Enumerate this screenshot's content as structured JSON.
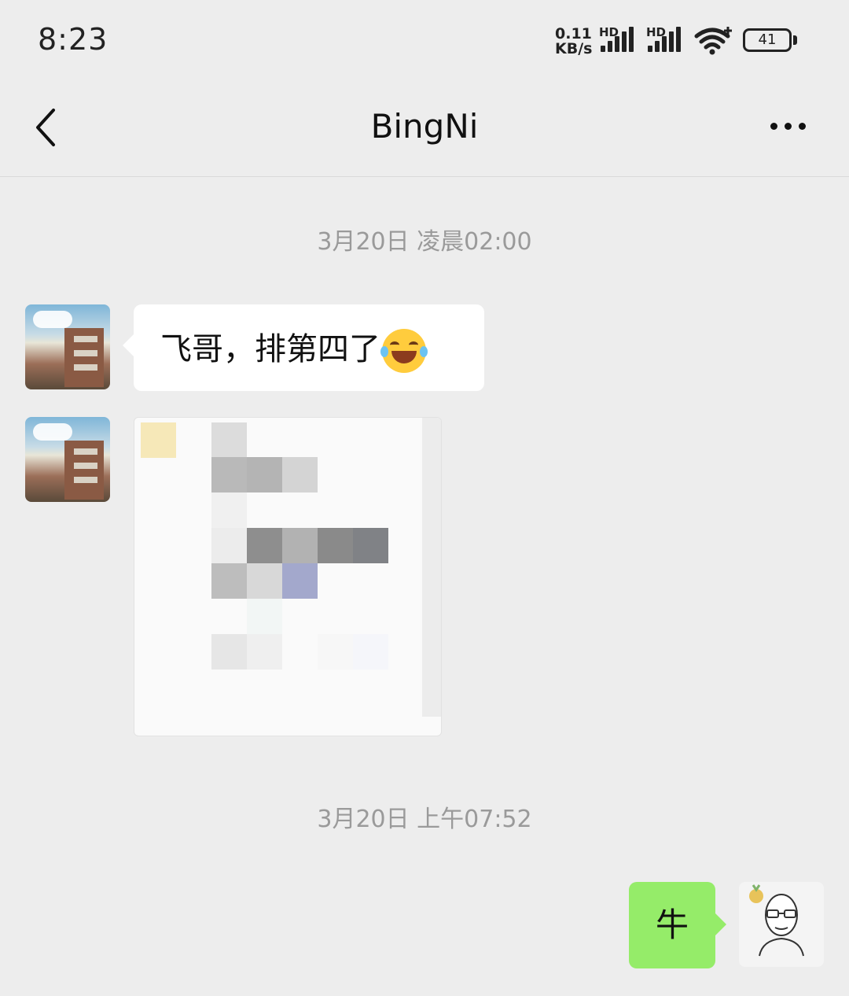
{
  "status_bar": {
    "time": "8:23",
    "net_speed_value": "0.11",
    "net_speed_unit": "KB/s",
    "signal_label_1": "HD",
    "signal_label_2": "HD",
    "battery_level": "41",
    "icons": [
      "signal-icon",
      "signal-icon",
      "wifi-icon",
      "battery-icon"
    ]
  },
  "nav": {
    "title": "BingNi",
    "back_icon": "chevron-left-icon",
    "more_icon": "more-dots-icon"
  },
  "messages": [
    {
      "type": "timestamp",
      "text": "3月20日 凌晨02:00"
    },
    {
      "type": "incoming_text",
      "text": "飞哥，排第四了",
      "emoji": "laughing-tears-emoji"
    },
    {
      "type": "incoming_image",
      "note": "pixelated image"
    },
    {
      "type": "timestamp",
      "text": "3月20日 上午07:52"
    },
    {
      "type": "outgoing_text",
      "text": "牛"
    }
  ],
  "colors": {
    "background": "#ededed",
    "outgoing_bubble": "#95ec69",
    "incoming_bubble": "#ffffff",
    "timestamp": "#9a9a9a"
  }
}
